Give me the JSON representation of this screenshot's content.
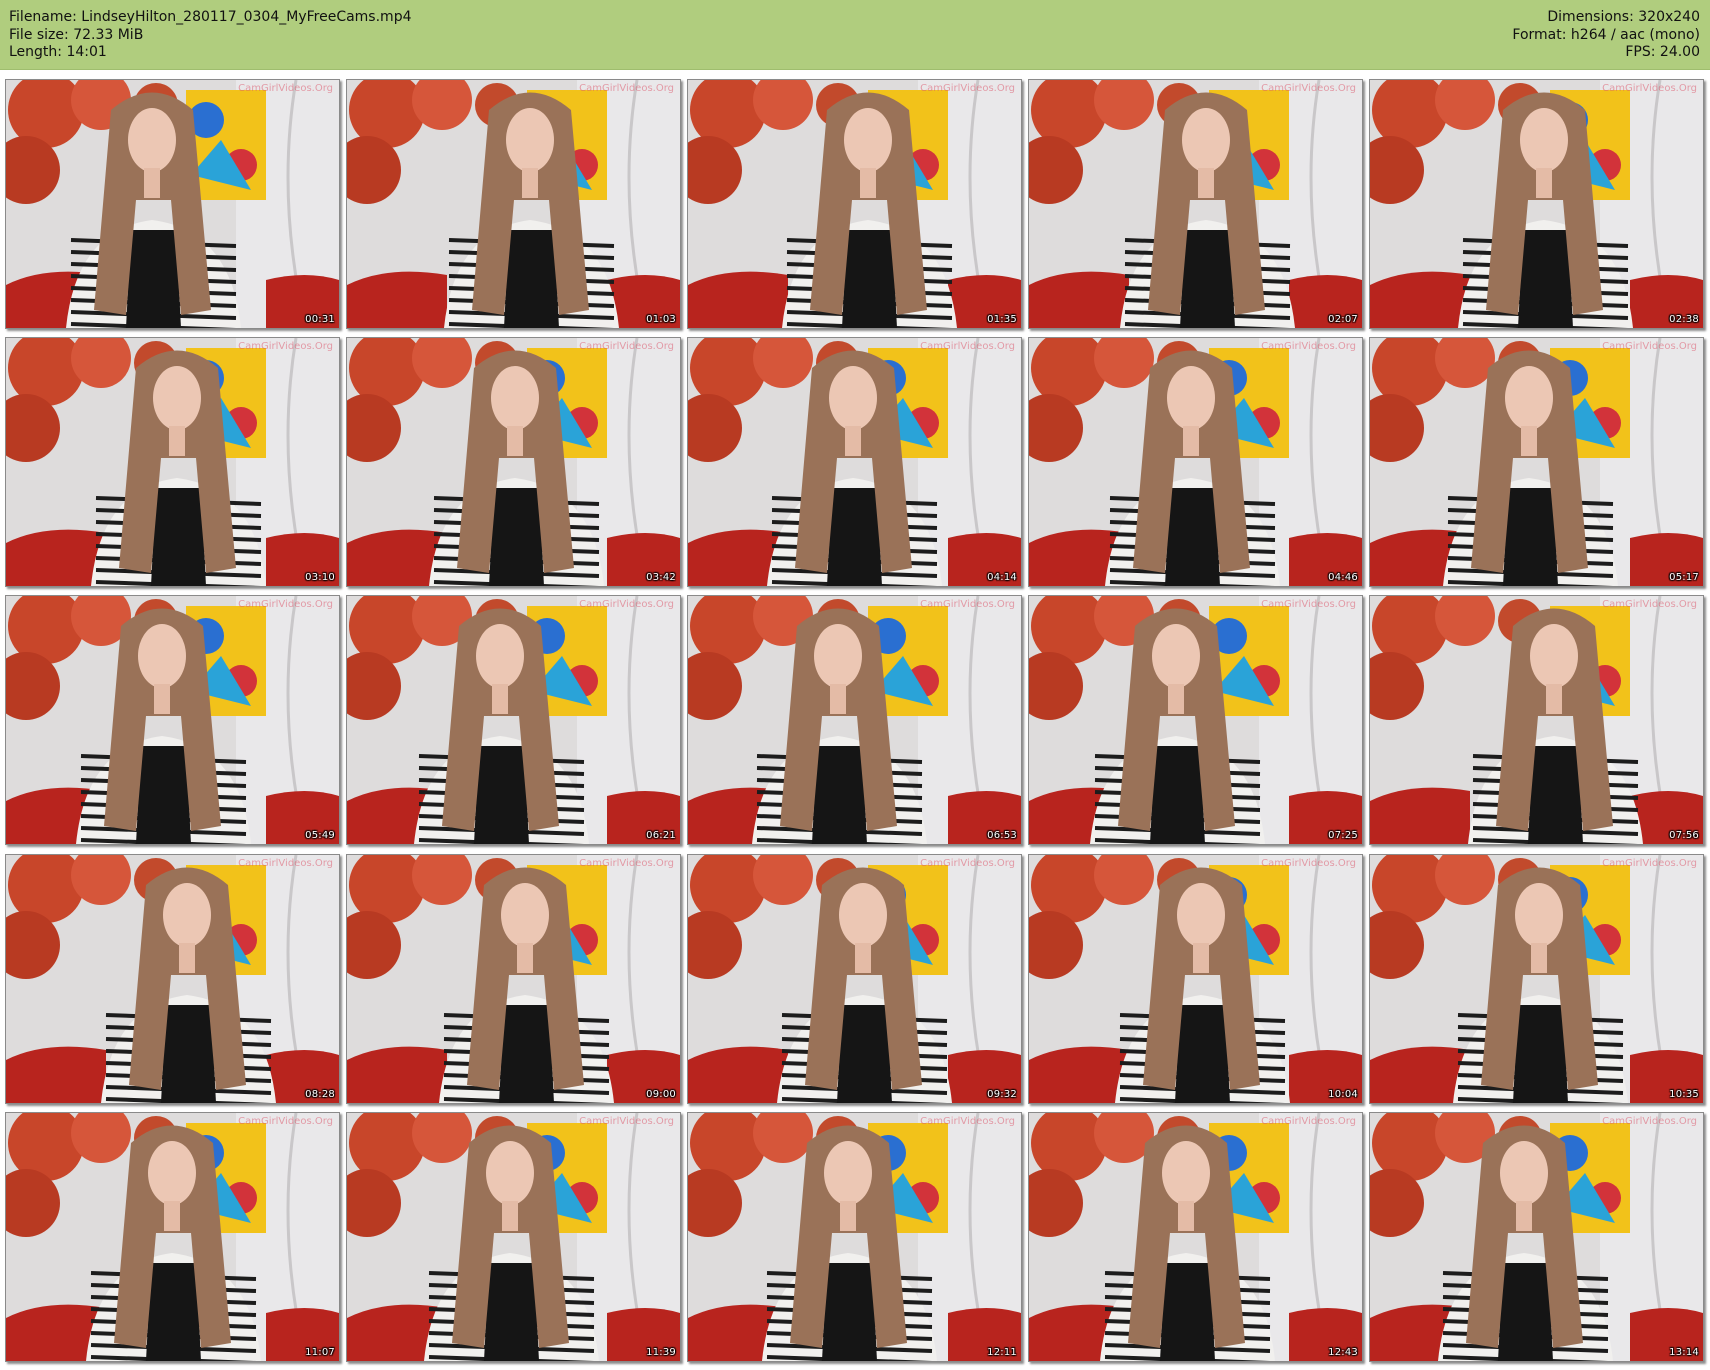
{
  "header": {
    "filename_line": "Filename: LindseyHilton_280117_0304_MyFreeCams.mp4",
    "filesize_line": "File size: 72.33 MiB",
    "length_line": "Length: 14:01",
    "dimensions_line": "Dimensions: 320x240",
    "format_line": "Format: h264 / aac (mono)",
    "fps_line": "FPS: 24.00"
  },
  "watermark": "CamGirlVideos.Org",
  "colors": {
    "header_bg": "#b0cd7e",
    "wall": "#dedcdc",
    "leaves": "#c8462a",
    "couch": "#b8241e",
    "hair": "#9a7258",
    "stripes": "#1c1c1c"
  },
  "thumbnails": [
    {
      "timestamp": "00:31"
    },
    {
      "timestamp": "01:03"
    },
    {
      "timestamp": "01:35"
    },
    {
      "timestamp": "02:07"
    },
    {
      "timestamp": "02:38"
    },
    {
      "timestamp": "03:10"
    },
    {
      "timestamp": "03:42"
    },
    {
      "timestamp": "04:14"
    },
    {
      "timestamp": "04:46"
    },
    {
      "timestamp": "05:17"
    },
    {
      "timestamp": "05:49"
    },
    {
      "timestamp": "06:21"
    },
    {
      "timestamp": "06:53"
    },
    {
      "timestamp": "07:25"
    },
    {
      "timestamp": "07:56"
    },
    {
      "timestamp": "08:28"
    },
    {
      "timestamp": "09:00"
    },
    {
      "timestamp": "09:32"
    },
    {
      "timestamp": "10:04"
    },
    {
      "timestamp": "10:35"
    },
    {
      "timestamp": "11:07"
    },
    {
      "timestamp": "11:39"
    },
    {
      "timestamp": "12:11"
    },
    {
      "timestamp": "12:43"
    },
    {
      "timestamp": "13:14"
    }
  ]
}
